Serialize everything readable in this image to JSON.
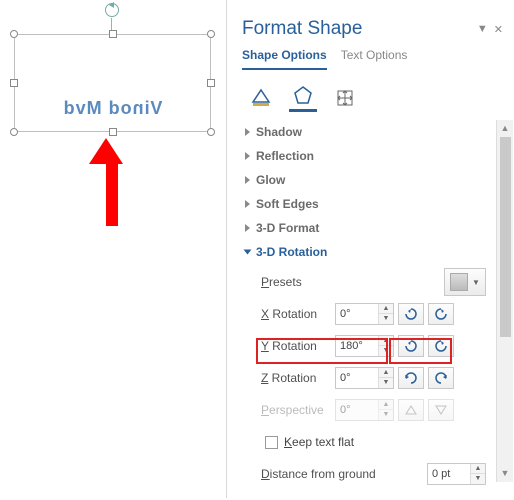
{
  "panel": {
    "title": "Format Shape",
    "tabs": {
      "shape": "Shape Options",
      "text": "Text Options"
    }
  },
  "shape_text": "Vinod Mvd",
  "sections": {
    "shadow": "Shadow",
    "reflection": "Reflection",
    "glow": "Glow",
    "soft_edges": "Soft Edges",
    "format3d": "3-D Format",
    "rotation3d": "3-D Rotation"
  },
  "rotation": {
    "presets_label": "Presets",
    "x": {
      "prefix": "X",
      "label": " Rotation",
      "value": "0°"
    },
    "y": {
      "prefix": "Y",
      "label": " Rotation",
      "value": "180°"
    },
    "z": {
      "prefix": "Z",
      "label": " Rotation",
      "value": "0°"
    },
    "perspective": {
      "prefix": "P",
      "label": "erspective",
      "value": "0°"
    },
    "keep_flat": {
      "prefix": "K",
      "label": "eep text flat"
    },
    "distance": {
      "prefix": "D",
      "label": "istance from ground",
      "value": "0 pt"
    }
  }
}
